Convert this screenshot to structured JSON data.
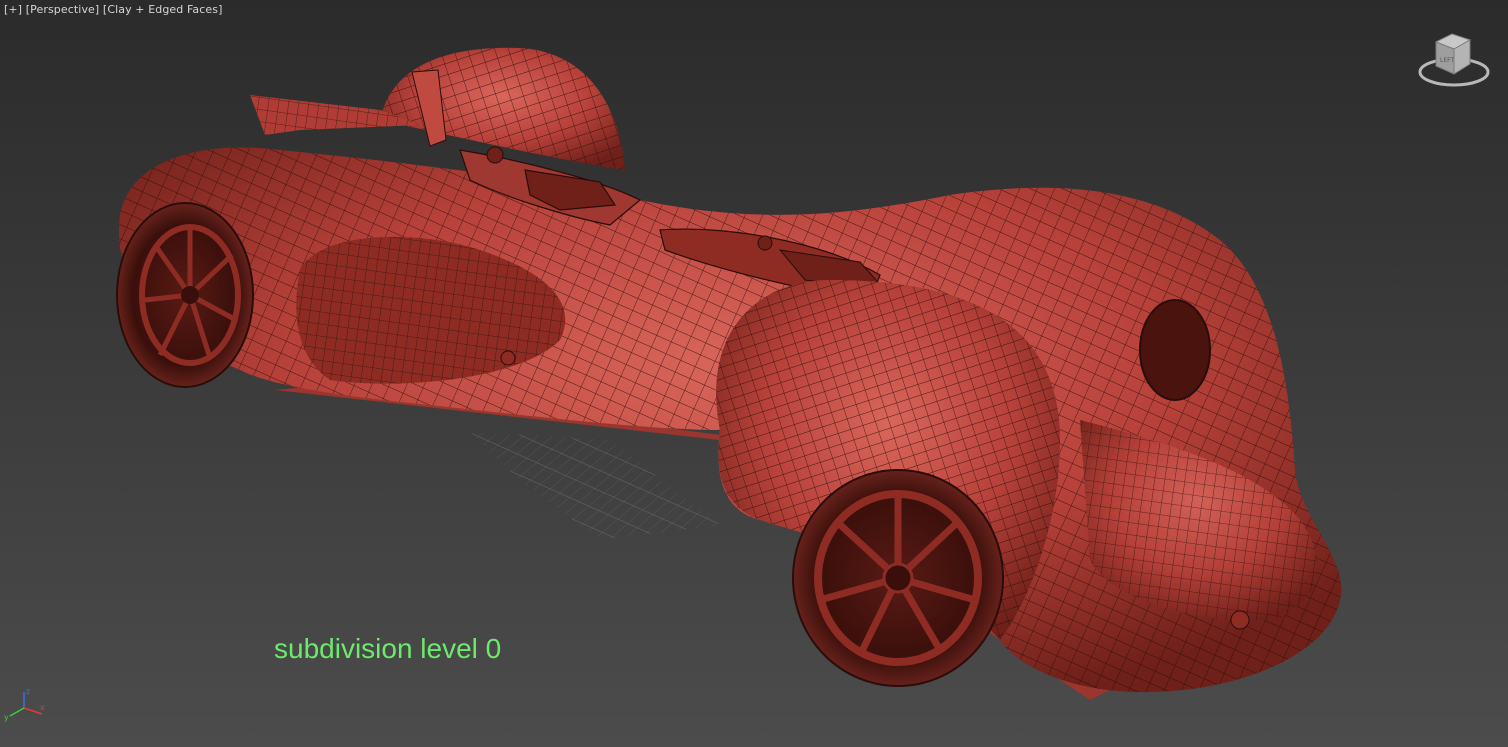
{
  "viewport": {
    "label_plus": "[+]",
    "label_view": "[Perspective]",
    "label_shading": "[Clay + Edged Faces]",
    "overlay_text": "subdivision level 0",
    "overlay_color": "#6bea6b",
    "model_color": "#b8423a",
    "wire_color": "#2a0d0b",
    "background_color": "#3a3a3a"
  },
  "viewcube": {
    "face_label": "LEFT"
  },
  "axis": {
    "x": "x",
    "y": "y",
    "z": "z"
  }
}
